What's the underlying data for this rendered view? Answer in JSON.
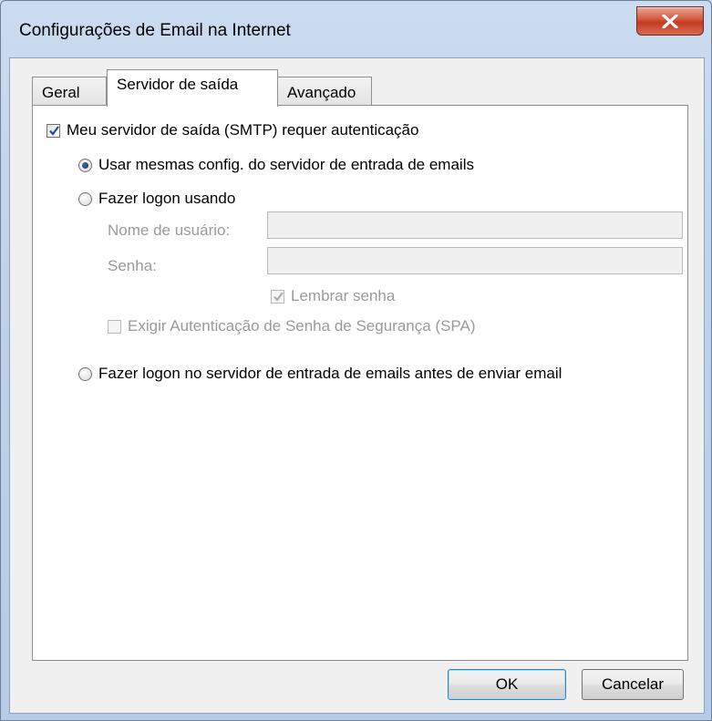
{
  "window": {
    "title": "Configurações de Email na Internet"
  },
  "tabs": [
    {
      "label": "Geral"
    },
    {
      "label": "Servidor de saída"
    },
    {
      "label": "Avançado"
    }
  ],
  "outgoing": {
    "smtp_auth": {
      "label": "Meu servidor de saída (SMTP) requer autenticação",
      "checked": true
    },
    "use_same": {
      "label": "Usar mesmas config. do servidor de entrada de emails",
      "checked": true
    },
    "logon_using": {
      "label": "Fazer logon usando",
      "checked": false
    },
    "username": {
      "label": "Nome de usuário:",
      "value": ""
    },
    "password": {
      "label": "Senha:",
      "value": ""
    },
    "remember_password": {
      "label": "Lembrar senha",
      "checked": true,
      "disabled": true
    },
    "spa": {
      "label": "Exigir Autenticação de Senha de Segurança (SPA)",
      "checked": false,
      "disabled": true
    },
    "logon_incoming_first": {
      "label": "Fazer logon no servidor de entrada de emails antes de enviar email",
      "checked": false
    }
  },
  "buttons": {
    "ok": "OK",
    "cancel": "Cancelar"
  }
}
